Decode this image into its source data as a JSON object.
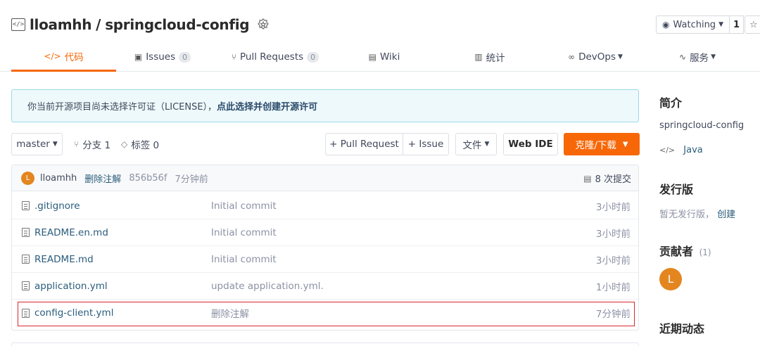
{
  "repo": {
    "owner": "lloamhh",
    "separator": "/",
    "name": "springcloud-config",
    "icon": "repo-code-icon",
    "badge_icon": "recommend-badge-icon"
  },
  "watch": {
    "label": "Watching",
    "count": "1"
  },
  "tabs": [
    {
      "label": "代码",
      "icon": "code-icon",
      "active": true
    },
    {
      "label": "Issues",
      "icon": "issues-icon",
      "count": "0"
    },
    {
      "label": "Pull Requests",
      "icon": "pull-request-icon",
      "count": "0"
    },
    {
      "label": "Wiki",
      "icon": "wiki-icon"
    },
    {
      "label": "统计",
      "icon": "stats-icon"
    },
    {
      "label": "DevOps",
      "icon": "devops-icon"
    },
    {
      "label": "服务",
      "icon": "service-icon"
    }
  ],
  "notice": {
    "text": "你当前开源项目尚未选择许可证（LICENSE），",
    "link": "点此选择并创建开源许可"
  },
  "toolbar": {
    "branch": "master",
    "branches_label": "分支 1",
    "tags_label": "标签 0",
    "pull_request": "+ Pull Request",
    "issue": "+ Issue",
    "file": "文件",
    "web_ide": "Web IDE",
    "clone": "克隆/下载"
  },
  "last_commit": {
    "avatar_letter": "L",
    "user": "lloamhh",
    "message": "删除注解",
    "hash": "856b56f",
    "time": "7分钟前",
    "count_label": "8 次提交"
  },
  "files": [
    {
      "name": ".gitignore",
      "message": "Initial commit",
      "time": "3小时前"
    },
    {
      "name": "README.en.md",
      "message": "Initial commit",
      "time": "3小时前"
    },
    {
      "name": "README.md",
      "message": "Initial commit",
      "time": "3小时前"
    },
    {
      "name": "application.yml",
      "message": "update application.yml.",
      "time": "1小时前"
    },
    {
      "name": "config-client.yml",
      "message": "删除注解",
      "time": "7分钟前"
    }
  ],
  "sidebar": {
    "intro_title": "简介",
    "description": "springcloud-config",
    "language": "Java",
    "release_title": "发行版",
    "release_text": "暂无发行版，",
    "release_link": "创建",
    "contributors_title": "贡献者",
    "contributors_count": "(1)",
    "contributor_letter": "L",
    "activity_title": "近期动态"
  },
  "colors": {
    "accent": "#f76707",
    "link": "#2a5d7c",
    "highlight": "#d9272e",
    "avatar": "#e3861f"
  }
}
